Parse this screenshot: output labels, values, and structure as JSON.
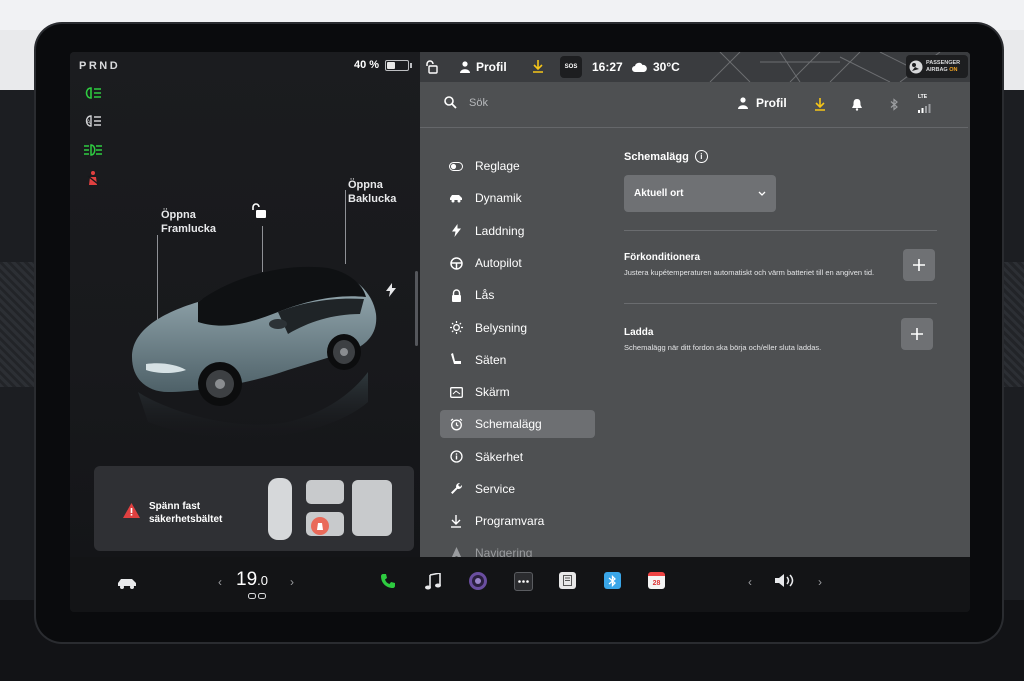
{
  "drive": {
    "gear_letters": "PRND",
    "battery_percent_label": "40 %",
    "battery_level": 0.4
  },
  "car_view": {
    "frunk_label_line1": "Öppna",
    "frunk_label_line2": "Framlucka",
    "trunk_label_line1": "Öppna",
    "trunk_label_line2": "Baklucka",
    "icons": [
      "headlights-icon",
      "auto-high-beam-icon",
      "fog-lights-icon",
      "seatbelt-warning-icon",
      "unlock-icon",
      "charge-bolt-icon"
    ]
  },
  "alert": {
    "line1": "Spänn fast",
    "line2": "säkerhetsbältet",
    "icon": "warning-icon"
  },
  "status_bar": {
    "profile_label": "Profil",
    "sos_label": "SOS",
    "time": "16:27",
    "temperature": "30°C",
    "airbag_line1": "PASSENGER",
    "airbag_line2": "AIRBAG",
    "airbag_state": "ON"
  },
  "toolbar": {
    "search_placeholder": "Sök",
    "profile_label": "Profil",
    "lte_label": "LTE"
  },
  "menu": {
    "items": [
      {
        "label": "Reglage",
        "icon": "toggle-icon"
      },
      {
        "label": "Dynamik",
        "icon": "car-icon"
      },
      {
        "label": "Laddning",
        "icon": "bolt-icon"
      },
      {
        "label": "Autopilot",
        "icon": "steering-wheel-icon"
      },
      {
        "label": "Lås",
        "icon": "lock-icon"
      },
      {
        "label": "Belysning",
        "icon": "sun-icon"
      },
      {
        "label": "Säten",
        "icon": "seat-icon"
      },
      {
        "label": "Skärm",
        "icon": "display-icon"
      },
      {
        "label": "Schemalägg",
        "icon": "alarm-clock-icon",
        "active": true
      },
      {
        "label": "Säkerhet",
        "icon": "info-circle-icon"
      },
      {
        "label": "Service",
        "icon": "wrench-icon"
      },
      {
        "label": "Programvara",
        "icon": "download-icon"
      },
      {
        "label": "Navigering",
        "icon": "navigation-arrow-icon"
      }
    ]
  },
  "schedule": {
    "title": "Schemalägg",
    "location_dropdown": "Aktuell ort",
    "precondition_title": "Förkonditionera",
    "precondition_desc": "Justera kupétemperaturen automatiskt och värm batteriet till en angiven tid.",
    "charge_title": "Ladda",
    "charge_desc": "Schemalägg när ditt fordon ska börja och/eller sluta laddas."
  },
  "dock": {
    "temp_whole": "19",
    "temp_decimal": ".0",
    "calendar_day": "28",
    "icons": [
      "car-icon",
      "climate-icon",
      "phone-icon",
      "music-icon",
      "camera-icon",
      "more-icon",
      "toybox-icon",
      "bluetooth-app-icon",
      "calendar-icon",
      "volume-icon"
    ]
  },
  "colors": {
    "accent_green": "#2ecc40",
    "warning_red": "#e04040",
    "download_yellow": "#f5c518",
    "airbag_on": "#f5a623",
    "panel_gray": "#4e5052"
  }
}
